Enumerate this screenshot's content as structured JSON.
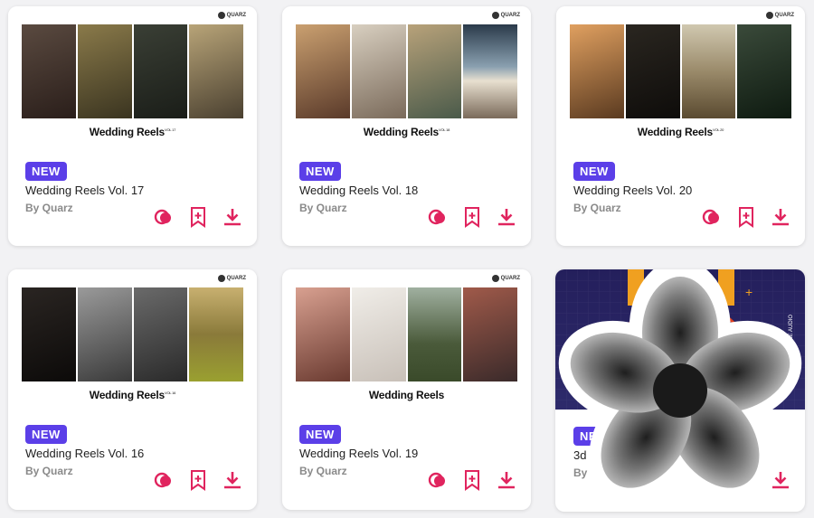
{
  "cards": [
    {
      "badge": "NEW",
      "title": "Wedding Reels Vol. 17",
      "author": "By Quarz",
      "thumb_title": "Wedding Reels",
      "thumb_sup": "VOL 17",
      "brand": "QUARZ",
      "panels": [
        "#3a2e2a",
        "#6a5a3b",
        "#2b2f2a",
        "#7a6a4a"
      ]
    },
    {
      "badge": "NEW",
      "title": "Wedding Reels Vol. 18",
      "author": "By Quarz",
      "thumb_title": "Wedding Reels",
      "thumb_sup": "VOL 18",
      "brand": "QUARZ",
      "panels": [
        "#8a6a4a",
        "#b9ab95",
        "#9a8a6a",
        "#5b7a8a"
      ]
    },
    {
      "badge": "NEW",
      "title": "Wedding Reels Vol. 20",
      "author": "By Quarz",
      "thumb_title": "Wedding Reels",
      "thumb_sup": "VOL 20",
      "brand": "QUARZ",
      "panels": [
        "#9a6a3a",
        "#1d1a16",
        "#8a7a5a",
        "#2a3a2a"
      ]
    },
    {
      "badge": "NEW",
      "title": "Wedding Reels Vol. 16",
      "author": "By Quarz",
      "thumb_title": "Wedding Reels",
      "thumb_sup": "VOL 16",
      "brand": "QUARZ",
      "panels": [
        "#1f1c1a",
        "#6b6b6b",
        "#5a5a5a",
        "#9a8a3a"
      ]
    },
    {
      "badge": "NEW",
      "title": "Wedding Reels Vol. 19",
      "author": "By Quarz",
      "thumb_title": "Wedding Reels",
      "thumb_sup": "",
      "brand": "QUARZ",
      "panels": [
        "#7a4a3a",
        "#e4e1dc",
        "#3a4a2a",
        "#6a3a3a"
      ]
    },
    {
      "badge": "NEW",
      "title_partial_start": "3d",
      "title_partial_end": "0",
      "author_partial": "By",
      "side_text": "TIMELINE AUDIO"
    }
  ],
  "actions": {
    "icons": [
      "overlap-circles-icon",
      "bookmark-add-icon",
      "download-icon"
    ]
  },
  "colors": {
    "accent": "#e0245e",
    "badge": "#5b3fe8"
  }
}
